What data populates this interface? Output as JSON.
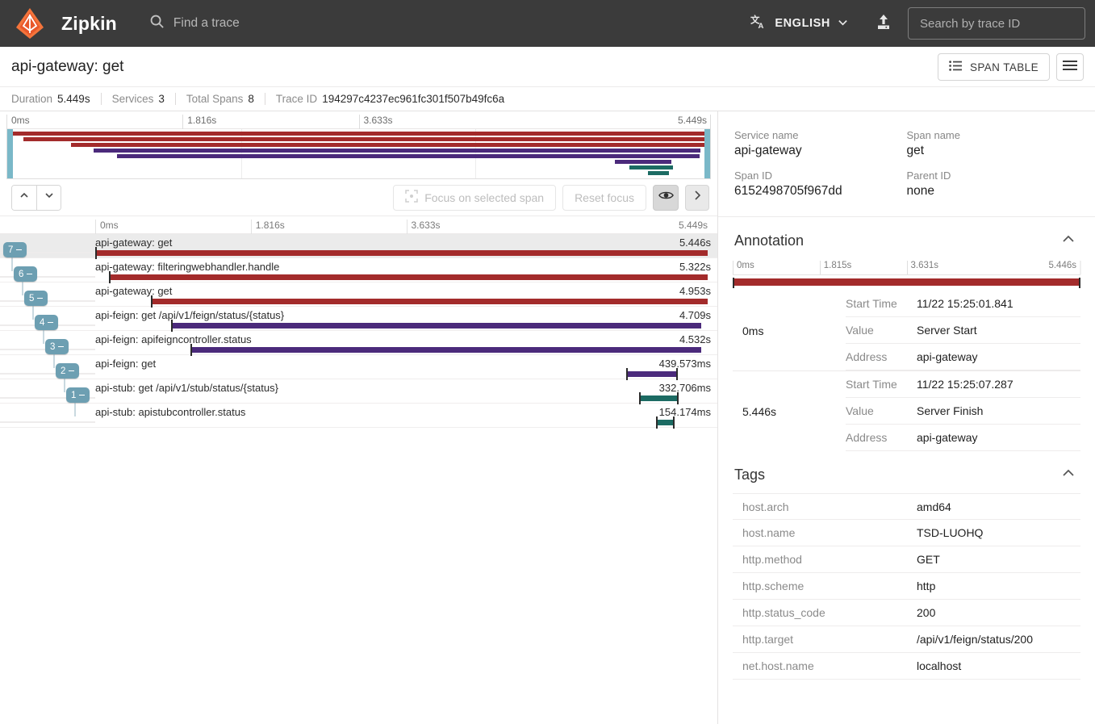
{
  "nav": {
    "brand": "Zipkin",
    "logo_icon": "zipkin-logo-icon",
    "search_icon": "search-icon",
    "find_trace_label": "Find a trace",
    "translate_icon": "translate-icon",
    "language": "ENGLISH",
    "chevron_down_icon": "chevron-down-icon",
    "upload_icon": "upload-icon",
    "trace_id_placeholder": "Search by trace ID",
    "trace_id_value": ""
  },
  "trace": {
    "title": "api-gateway: get",
    "span_table_label": "SPAN TABLE",
    "span_table_icon": "list-icon",
    "menu_icon": "hamburger-menu-icon",
    "meta": [
      {
        "key": "Duration",
        "value": "5.449s"
      },
      {
        "key": "Services",
        "value": "3"
      },
      {
        "key": "Total Spans",
        "value": "8"
      },
      {
        "key": "Trace ID",
        "value": "194297c4237ec961fc301f507b49fc6a"
      }
    ]
  },
  "minimap": {
    "ticks": [
      "0ms",
      "1.816s",
      "3.633s",
      "5.449s"
    ],
    "bars": [
      {
        "left_pct": 0.0,
        "width_pct": 100.0,
        "color": "#a32b2b"
      },
      {
        "left_pct": 2.3,
        "width_pct": 97.7,
        "color": "#a32b2b"
      },
      {
        "left_pct": 9.1,
        "width_pct": 90.9,
        "color": "#a32b2b"
      },
      {
        "left_pct": 12.3,
        "width_pct": 86.3,
        "color": "#4b2a7b"
      },
      {
        "left_pct": 15.6,
        "width_pct": 82.9,
        "color": "#4b2a7b"
      },
      {
        "left_pct": 86.4,
        "width_pct": 8.1,
        "color": "#4b2a7b"
      },
      {
        "left_pct": 88.5,
        "width_pct": 6.2,
        "color": "#1c6b63"
      },
      {
        "left_pct": 91.2,
        "width_pct": 2.9,
        "color": "#1c6b63"
      }
    ]
  },
  "toolbar": {
    "up_icon": "chevron-up-icon",
    "down_icon": "chevron-down-icon",
    "focus_icon": "crosshair-icon",
    "focus_label": "Focus on selected span",
    "reset_label": "Reset focus",
    "eye_icon": "eye-icon",
    "next_icon": "chevron-right-icon"
  },
  "timeline": {
    "ticks": [
      "0ms",
      "1.816s",
      "3.633s",
      "5.449s"
    ],
    "spans": [
      {
        "badge": "7",
        "depth": 0,
        "label": "api-gateway: get",
        "duration": "5.446s",
        "left_pct": 0.0,
        "width_pct": 99.8,
        "color": "#a32b2b",
        "selected": true
      },
      {
        "badge": "6",
        "depth": 1,
        "label": "api-gateway: filteringwebhandler.handle",
        "duration": "5.322s",
        "left_pct": 2.2,
        "width_pct": 97.6,
        "color": "#a32b2b",
        "selected": false
      },
      {
        "badge": "5",
        "depth": 2,
        "label": "api-gateway: get",
        "duration": "4.953s",
        "left_pct": 9.1,
        "width_pct": 90.7,
        "color": "#a32b2b",
        "selected": false
      },
      {
        "badge": "4",
        "depth": 3,
        "label": "api-feign: get /api/v1/feign/status/{status}",
        "duration": "4.709s",
        "left_pct": 12.3,
        "width_pct": 86.4,
        "color": "#4b2a7b",
        "selected": false
      },
      {
        "badge": "3",
        "depth": 4,
        "label": "api-feign: apifeigncontroller.status",
        "duration": "4.532s",
        "left_pct": 15.5,
        "width_pct": 83.2,
        "color": "#4b2a7b",
        "selected": false
      },
      {
        "badge": "2",
        "depth": 5,
        "label": "api-feign: get",
        "duration": "439.573ms",
        "left_pct": 86.5,
        "width_pct": 8.1,
        "color": "#4b2a7b",
        "selected": false
      },
      {
        "badge": "1",
        "depth": 6,
        "label": "api-stub: get /api/v1/stub/status/{status}",
        "duration": "332.706ms",
        "left_pct": 88.6,
        "width_pct": 6.1,
        "color": "#1c6b63",
        "selected": false
      },
      {
        "badge": "",
        "depth": 7,
        "label": "api-stub: apistubcontroller.status",
        "duration": "154.174ms",
        "left_pct": 91.3,
        "width_pct": 2.8,
        "color": "#1c6b63",
        "selected": false
      }
    ]
  },
  "detail": {
    "service_name_label": "Service name",
    "service_name_value": "api-gateway",
    "span_name_label": "Span name",
    "span_name_value": "get",
    "span_id_label": "Span ID",
    "span_id_value": "6152498705f967dd",
    "parent_id_label": "Parent ID",
    "parent_id_value": "none"
  },
  "annotation": {
    "title": "Annotation",
    "collapse_icon": "chevron-up-icon",
    "ticks": [
      "0ms",
      "1.815s",
      "3.631s",
      "5.446s"
    ],
    "bar_color": "#a32b2b",
    "groups": [
      {
        "timestamp": "0ms",
        "rows": [
          {
            "key": "Start Time",
            "value": "11/22 15:25:01.841"
          },
          {
            "key": "Value",
            "value": "Server Start"
          },
          {
            "key": "Address",
            "value": "api-gateway"
          }
        ]
      },
      {
        "timestamp": "5.446s",
        "rows": [
          {
            "key": "Start Time",
            "value": "11/22 15:25:07.287"
          },
          {
            "key": "Value",
            "value": "Server Finish"
          },
          {
            "key": "Address",
            "value": "api-gateway"
          }
        ]
      }
    ]
  },
  "tags": {
    "title": "Tags",
    "collapse_icon": "chevron-up-icon",
    "rows": [
      {
        "key": "host.arch",
        "value": "amd64"
      },
      {
        "key": "host.name",
        "value": "TSD-LUOHQ"
      },
      {
        "key": "http.method",
        "value": "GET"
      },
      {
        "key": "http.scheme",
        "value": "http"
      },
      {
        "key": "http.status_code",
        "value": "200"
      },
      {
        "key": "http.target",
        "value": "/api/v1/feign/status/200"
      },
      {
        "key": "net.host.name",
        "value": "localhost"
      }
    ]
  }
}
